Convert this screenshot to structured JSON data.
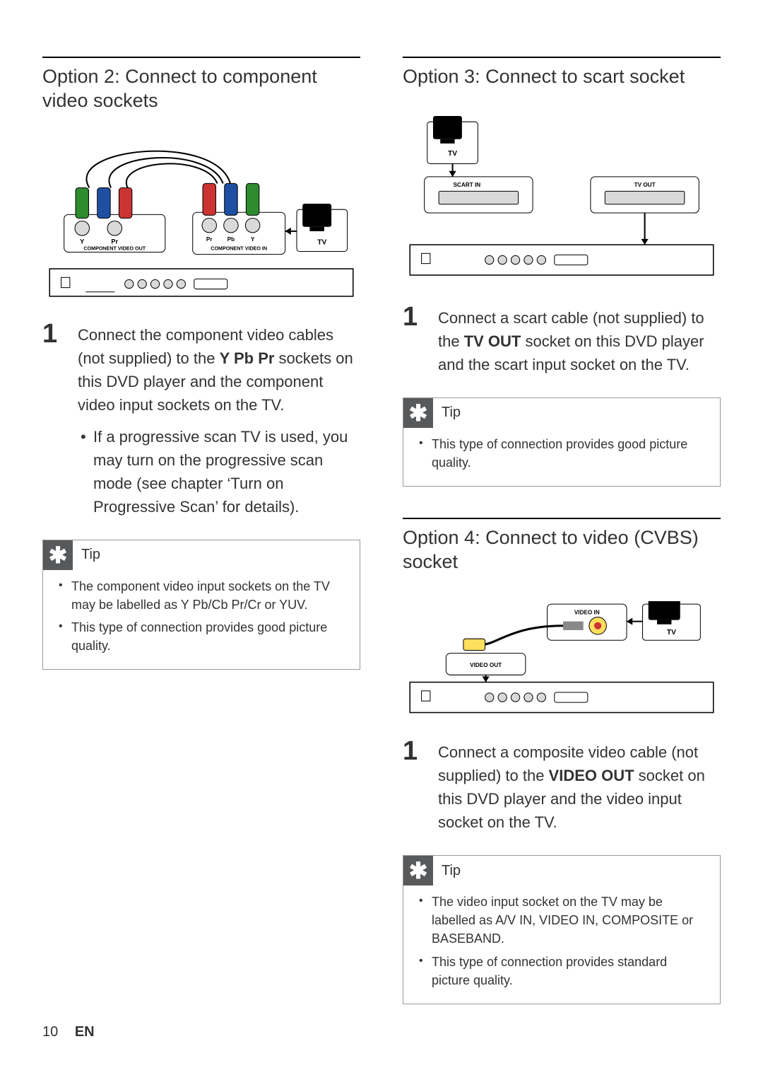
{
  "left": {
    "opt2": {
      "heading": "Option 2: Connect to component video sockets",
      "step_num": "1",
      "step_text_a": "Connect the component video cables (not supplied) to the ",
      "step_bold": "Y Pb Pr",
      "step_text_b": " sockets on this DVD player and the component video input sockets on the TV.",
      "sub_bullet": "If a progressive scan TV is used, you may turn on the progressive scan mode (see chapter ‘Turn on Progressive Scan’ for details).",
      "tip_label": "Tip",
      "tip_items": [
        "The component video input sockets on the TV may be labelled as Y Pb/Cb Pr/Cr or YUV.",
        "This type of connection provides good picture quality."
      ],
      "diagram": {
        "player_labels": [
          "Y",
          "Pr"
        ],
        "player_out": "COMPONENT VIDEO OUT",
        "tv_inputs": [
          "Pr",
          "Pb",
          "Y"
        ],
        "tv_in_label": "COMPONENT VIDEO IN",
        "tv_label": "TV"
      }
    }
  },
  "right": {
    "opt3": {
      "heading": "Option 3: Connect to scart socket",
      "step_num": "1",
      "step_text_a": "Connect a scart cable (not supplied) to the ",
      "step_bold": "TV OUT",
      "step_text_b": " socket on this DVD player and the scart input socket on the TV.",
      "tip_label": "Tip",
      "tip_items": [
        "This type of connection provides good picture quality."
      ],
      "diagram": {
        "tv_label": "TV",
        "scart_in": "SCART IN",
        "tv_out": "TV OUT"
      }
    },
    "opt4": {
      "heading": "Option 4: Connect to video (CVBS) socket",
      "step_num": "1",
      "step_text_a": "Connect a composite video cable (not supplied) to the ",
      "step_bold": "VIDEO OUT",
      "step_text_b": " socket on this DVD player and the video input socket on the TV.",
      "tip_label": "Tip",
      "tip_items": [
        "The video input socket on the TV may be labelled as A/V IN, VIDEO IN, COMPOSITE or BASEBAND.",
        "This type of connection provides standard picture quality."
      ],
      "diagram": {
        "video_in": "VIDEO IN",
        "video_out": "VIDEO OUT",
        "tv_label": "TV"
      }
    }
  },
  "footer": {
    "page": "10",
    "lang": "EN"
  },
  "tip_glyph": "✱"
}
